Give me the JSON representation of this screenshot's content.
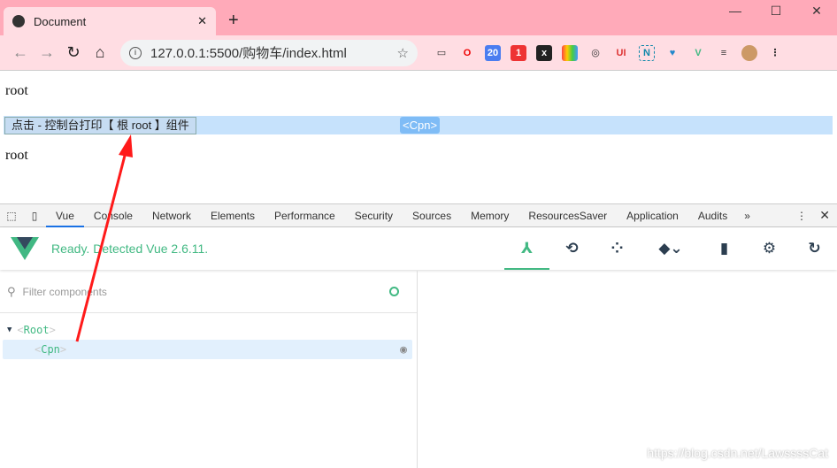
{
  "browser": {
    "tab_title": "Document",
    "url": "127.0.0.1:5500/购物车/index.html",
    "extension_badges": [
      "20",
      "1"
    ]
  },
  "page": {
    "text_top": "root",
    "button_label": "点击 - 控制台打印【 根 root 】组件",
    "component_tag": "<Cpn>",
    "text_bottom": "root"
  },
  "devtools": {
    "tabs": [
      "Vue",
      "Console",
      "Network",
      "Elements",
      "Performance",
      "Security",
      "Sources",
      "Memory",
      "ResourcesSaver",
      "Application",
      "Audits"
    ],
    "active_tab": "Vue"
  },
  "vue": {
    "status": "Ready. Detected Vue 2.6.11.",
    "filter_placeholder": "Filter components",
    "tree": [
      {
        "name": "Root"
      },
      {
        "name": "Cpn"
      }
    ],
    "accent": "#42b983"
  },
  "annotation": {
    "color": "#ff1a1a"
  },
  "watermark": "https://blog.csdn.net/LawssssCat"
}
